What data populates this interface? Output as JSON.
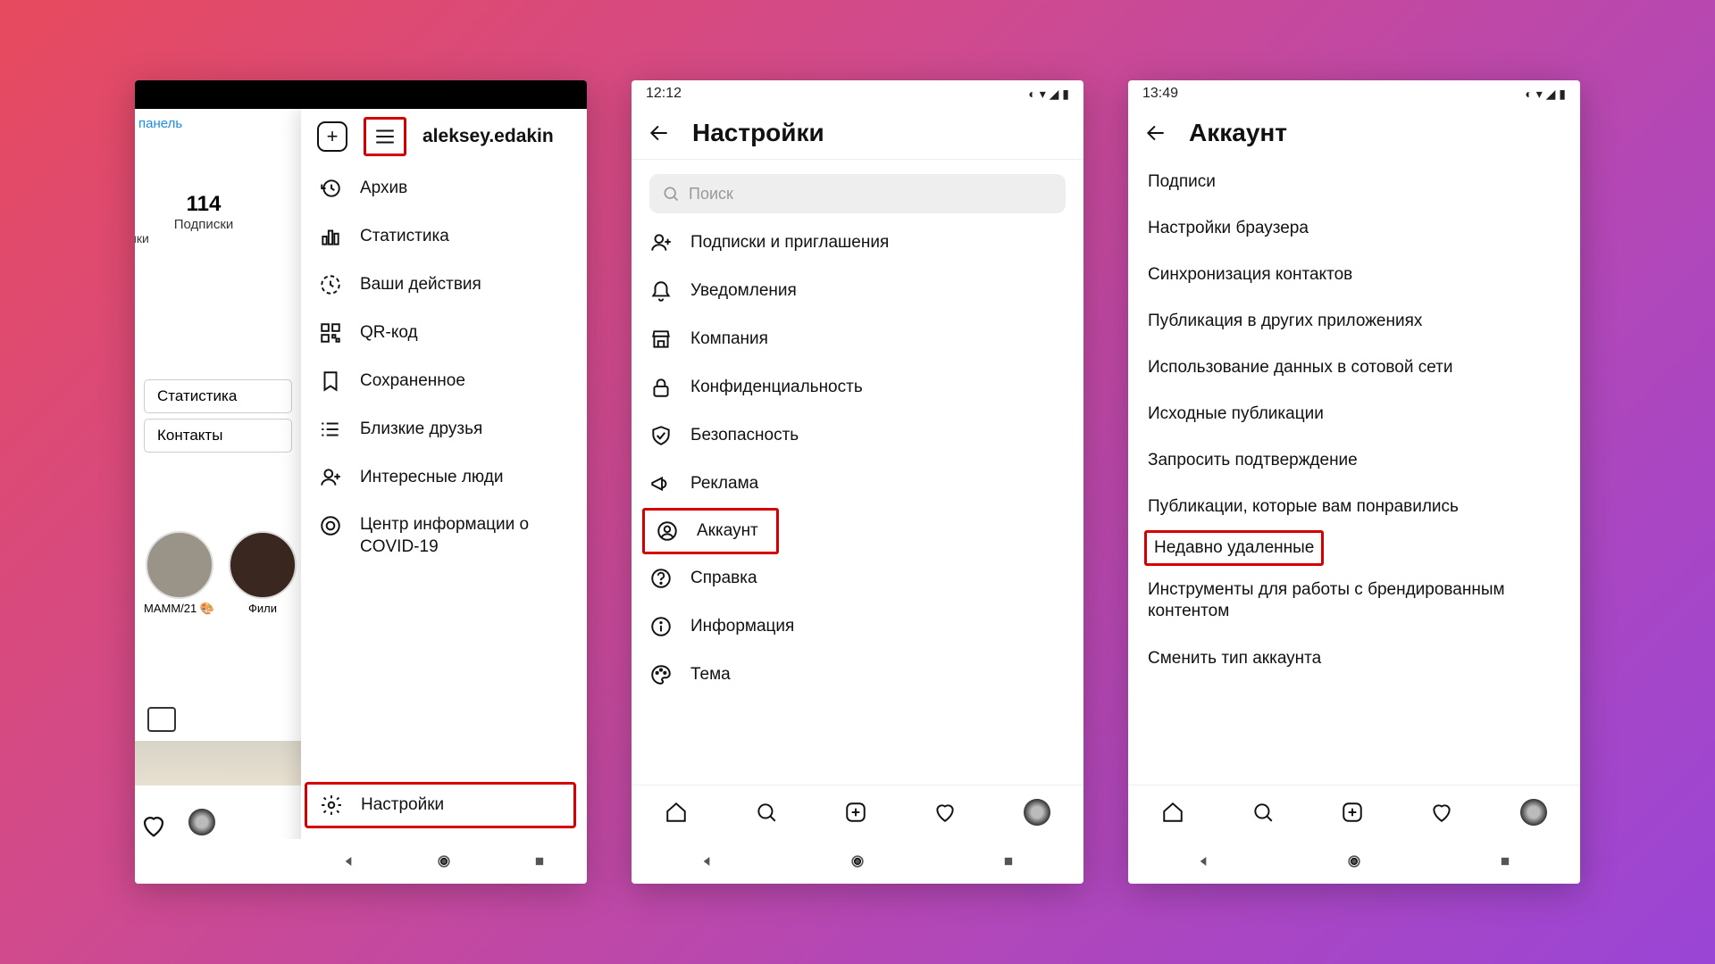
{
  "phone1": {
    "username": "aleksey.edakin",
    "panel_link": "панель",
    "partial_left": "ики",
    "stats": {
      "count": "114",
      "label": "Подписки"
    },
    "buttons": {
      "stats": "Статистика",
      "contacts": "Контакты"
    },
    "stories": [
      {
        "label": "MAMM/21 🎨"
      },
      {
        "label": "Фили"
      }
    ],
    "menu": [
      {
        "label": "Архив",
        "icon": "clock-back"
      },
      {
        "label": "Статистика",
        "icon": "bars"
      },
      {
        "label": "Ваши действия",
        "icon": "history"
      },
      {
        "label": "QR-код",
        "icon": "qr"
      },
      {
        "label": "Сохраненное",
        "icon": "bookmark"
      },
      {
        "label": "Близкие друзья",
        "icon": "list"
      },
      {
        "label": "Интересные люди",
        "icon": "person-add"
      },
      {
        "label": "Центр информации о COVID-19",
        "icon": "info-circle"
      }
    ],
    "settings_label": "Настройки"
  },
  "phone2": {
    "time": "12:12",
    "title": "Настройки",
    "search_placeholder": "Поиск",
    "items": [
      {
        "label": "Подписки и приглашения",
        "icon": "person-add"
      },
      {
        "label": "Уведомления",
        "icon": "bell"
      },
      {
        "label": "Компания",
        "icon": "store"
      },
      {
        "label": "Конфиденциальность",
        "icon": "lock"
      },
      {
        "label": "Безопасность",
        "icon": "shield"
      },
      {
        "label": "Реклама",
        "icon": "megaphone"
      },
      {
        "label": "Аккаунт",
        "icon": "account",
        "highlight": true
      },
      {
        "label": "Справка",
        "icon": "help"
      },
      {
        "label": "Информация",
        "icon": "info"
      },
      {
        "label": "Тема",
        "icon": "palette"
      }
    ]
  },
  "phone3": {
    "time": "13:49",
    "title": "Аккаунт",
    "items": [
      {
        "label": "Подписи"
      },
      {
        "label": "Настройки браузера"
      },
      {
        "label": "Синхронизация контактов"
      },
      {
        "label": "Публикация в других приложениях"
      },
      {
        "label": "Использование данных в сотовой сети"
      },
      {
        "label": "Исходные публикации"
      },
      {
        "label": "Запросить подтверждение"
      },
      {
        "label": "Публикации, которые вам понравились"
      },
      {
        "label": "Недавно удаленные",
        "highlight": true
      },
      {
        "label": "Инструменты для работы с брендированным контентом"
      },
      {
        "label": "Сменить тип аккаунта",
        "link": true
      }
    ]
  }
}
